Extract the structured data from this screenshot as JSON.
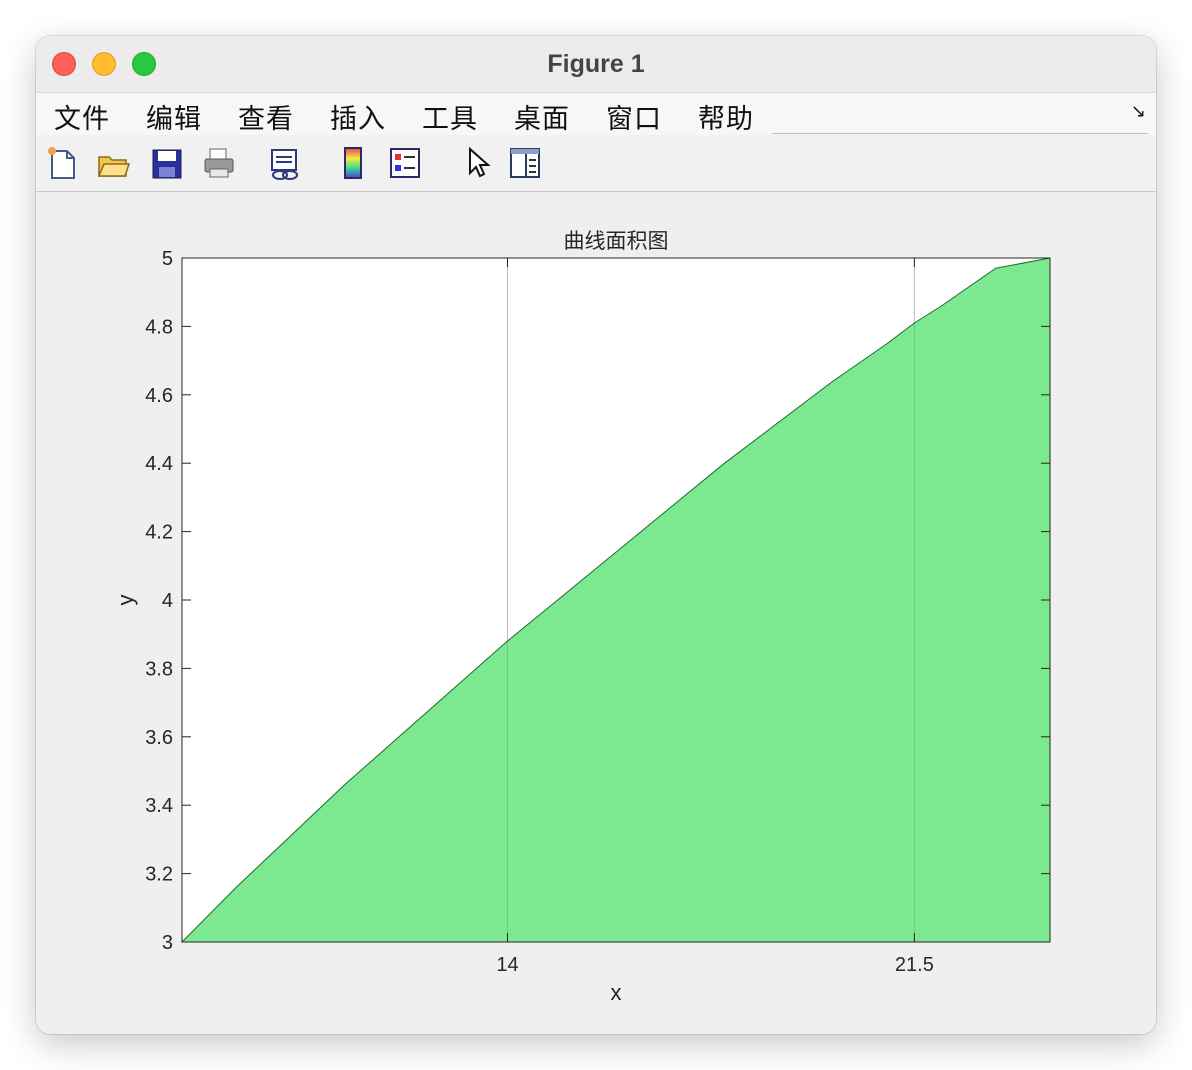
{
  "window": {
    "title": "Figure 1"
  },
  "menu": {
    "items": [
      "文件",
      "编辑",
      "查看",
      "插入",
      "工具",
      "桌面",
      "窗口",
      "帮助"
    ]
  },
  "toolbar": {
    "icons": [
      "new-figure-icon",
      "open-file-icon",
      "save-icon",
      "print-icon",
      "link-plot-icon",
      "colorbar-icon",
      "legend-icon",
      "pointer-icon",
      "property-editor-icon"
    ]
  },
  "colors": {
    "fill": "#7ce890",
    "edge": "#1f6b2e"
  },
  "chart_data": {
    "type": "area",
    "title": "曲线面积图",
    "xlabel": "x",
    "ylabel": "y",
    "xlim": [
      8,
      24
    ],
    "ylim": [
      3,
      5
    ],
    "xticks": [
      14,
      21.5
    ],
    "xtick_labels": [
      "14",
      "21.5"
    ],
    "yticks": [
      3,
      3.2,
      3.4,
      3.6,
      3.8,
      4,
      4.2,
      4.4,
      4.6,
      4.8,
      5
    ],
    "ytick_labels": [
      "3",
      "3.2",
      "3.4",
      "3.6",
      "3.8",
      "4",
      "4.2",
      "4.4",
      "4.6",
      "4.8",
      "5"
    ],
    "grid": "x-only",
    "series": [
      {
        "x": [
          8,
          9,
          10,
          11,
          12,
          13,
          14,
          15,
          16,
          17,
          18,
          19,
          20,
          21,
          21.5,
          22,
          23,
          24
        ],
        "y": [
          3,
          3.16,
          3.31,
          3.46,
          3.6,
          3.74,
          3.88,
          4.01,
          4.14,
          4.27,
          4.4,
          4.52,
          4.64,
          4.75,
          4.81,
          4.86,
          4.97,
          5
        ]
      }
    ]
  }
}
